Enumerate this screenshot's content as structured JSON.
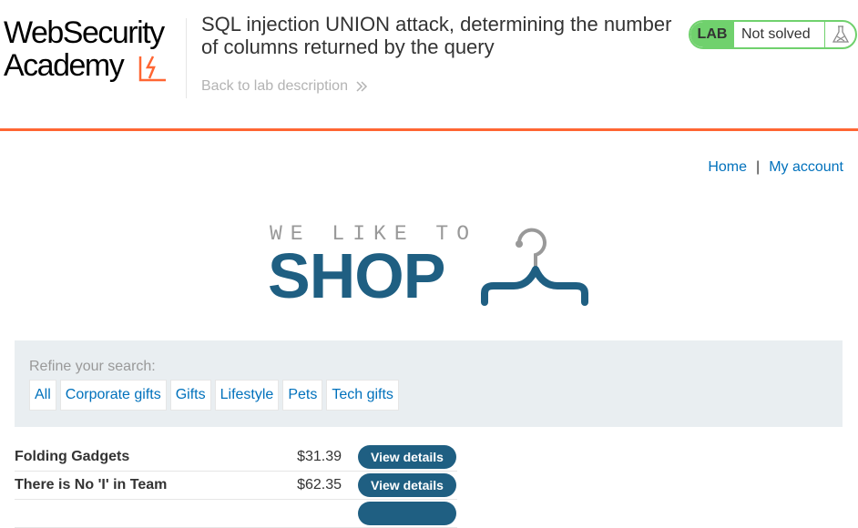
{
  "academy": {
    "logo_line1": "WebSecurity",
    "logo_line2": "Academy",
    "lab_title": "SQL injection UNION attack, determining the number of columns returned by the query",
    "back_link": "Back to lab description",
    "lab_badge": "LAB",
    "lab_status": "Not solved",
    "colors": {
      "accent": "#ff6633",
      "badge_green": "#70d16d"
    }
  },
  "nav": {
    "home": "Home",
    "separator": "|",
    "my_account": "My account"
  },
  "shop_logo": {
    "tagline": "WE LIKE TO",
    "word": "SHOP",
    "color": "#1f5f82"
  },
  "filters": {
    "label": "Refine your search:",
    "items": [
      "All",
      "Corporate gifts",
      "Gifts",
      "Lifestyle",
      "Pets",
      "Tech gifts"
    ]
  },
  "products": [
    {
      "name": "Folding Gadgets",
      "price": "$31.39",
      "button": "View details"
    },
    {
      "name": "There is No 'I' in Team",
      "price": "$62.35",
      "button": "View details"
    },
    {
      "name": "",
      "price": "",
      "button": ""
    }
  ]
}
